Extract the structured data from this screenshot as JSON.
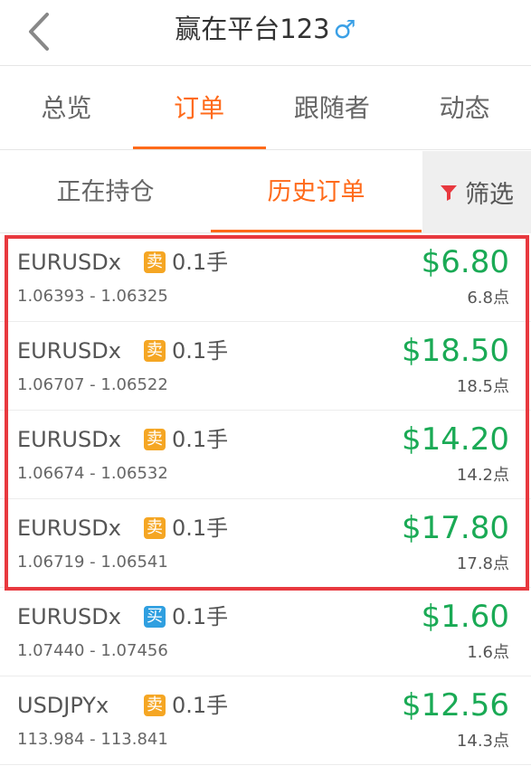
{
  "header": {
    "title": "赢在平台123",
    "gender_symbol": "♂"
  },
  "tabs": [
    {
      "label": "总览",
      "active": false
    },
    {
      "label": "订单",
      "active": true
    },
    {
      "label": "跟随者",
      "active": false
    },
    {
      "label": "动态",
      "active": false
    }
  ],
  "subtabs": [
    {
      "label": "正在持仓",
      "active": false
    },
    {
      "label": "历史订单",
      "active": true
    }
  ],
  "filter": {
    "label": "筛选"
  },
  "orders": [
    {
      "symbol": "EURUSDx",
      "side": "卖",
      "side_type": "sell",
      "lot": "0.1手",
      "prices": "1.06393 - 1.06325",
      "profit": "$6.80",
      "points": "6.8点"
    },
    {
      "symbol": "EURUSDx",
      "side": "卖",
      "side_type": "sell",
      "lot": "0.1手",
      "prices": "1.06707 - 1.06522",
      "profit": "$18.50",
      "points": "18.5点"
    },
    {
      "symbol": "EURUSDx",
      "side": "卖",
      "side_type": "sell",
      "lot": "0.1手",
      "prices": "1.06674 - 1.06532",
      "profit": "$14.20",
      "points": "14.2点"
    },
    {
      "symbol": "EURUSDx",
      "side": "卖",
      "side_type": "sell",
      "lot": "0.1手",
      "prices": "1.06719 - 1.06541",
      "profit": "$17.80",
      "points": "17.8点"
    },
    {
      "symbol": "EURUSDx",
      "side": "买",
      "side_type": "buy",
      "lot": "0.1手",
      "prices": "1.07440 - 1.07456",
      "profit": "$1.60",
      "points": "1.6点"
    },
    {
      "symbol": "USDJPYx",
      "side": "卖",
      "side_type": "sell",
      "lot": "0.1手",
      "prices": "113.984 - 113.841",
      "profit": "$12.56",
      "points": "14.3点"
    }
  ],
  "colors": {
    "accent": "#ff6a1a",
    "profit": "#1aaa55",
    "sell_badge": "#f5a623",
    "buy_badge": "#2f9fe0",
    "highlight": "#e8393f"
  }
}
